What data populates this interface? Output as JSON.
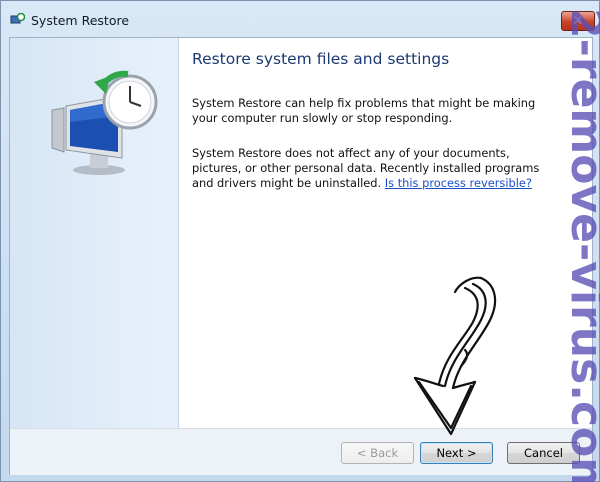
{
  "window": {
    "title": "System Restore",
    "close_label": "✕"
  },
  "content": {
    "heading": "Restore system files and settings",
    "para1": "System Restore can help fix problems that might be making your computer run slowly or stop responding.",
    "para2_text": "System Restore does not affect any of your documents, pictures, or other personal data. Recently installed programs and drivers might be uninstalled.",
    "para2_link": "Is this process reversible?"
  },
  "buttons": {
    "back": "< Back",
    "next": "Next >",
    "cancel": "Cancel"
  },
  "watermark": {
    "text": "2-remove-virus.com"
  },
  "colors": {
    "heading": "#1b3a74",
    "link": "#1a4ec9",
    "watermark": "#5b4fb5"
  }
}
